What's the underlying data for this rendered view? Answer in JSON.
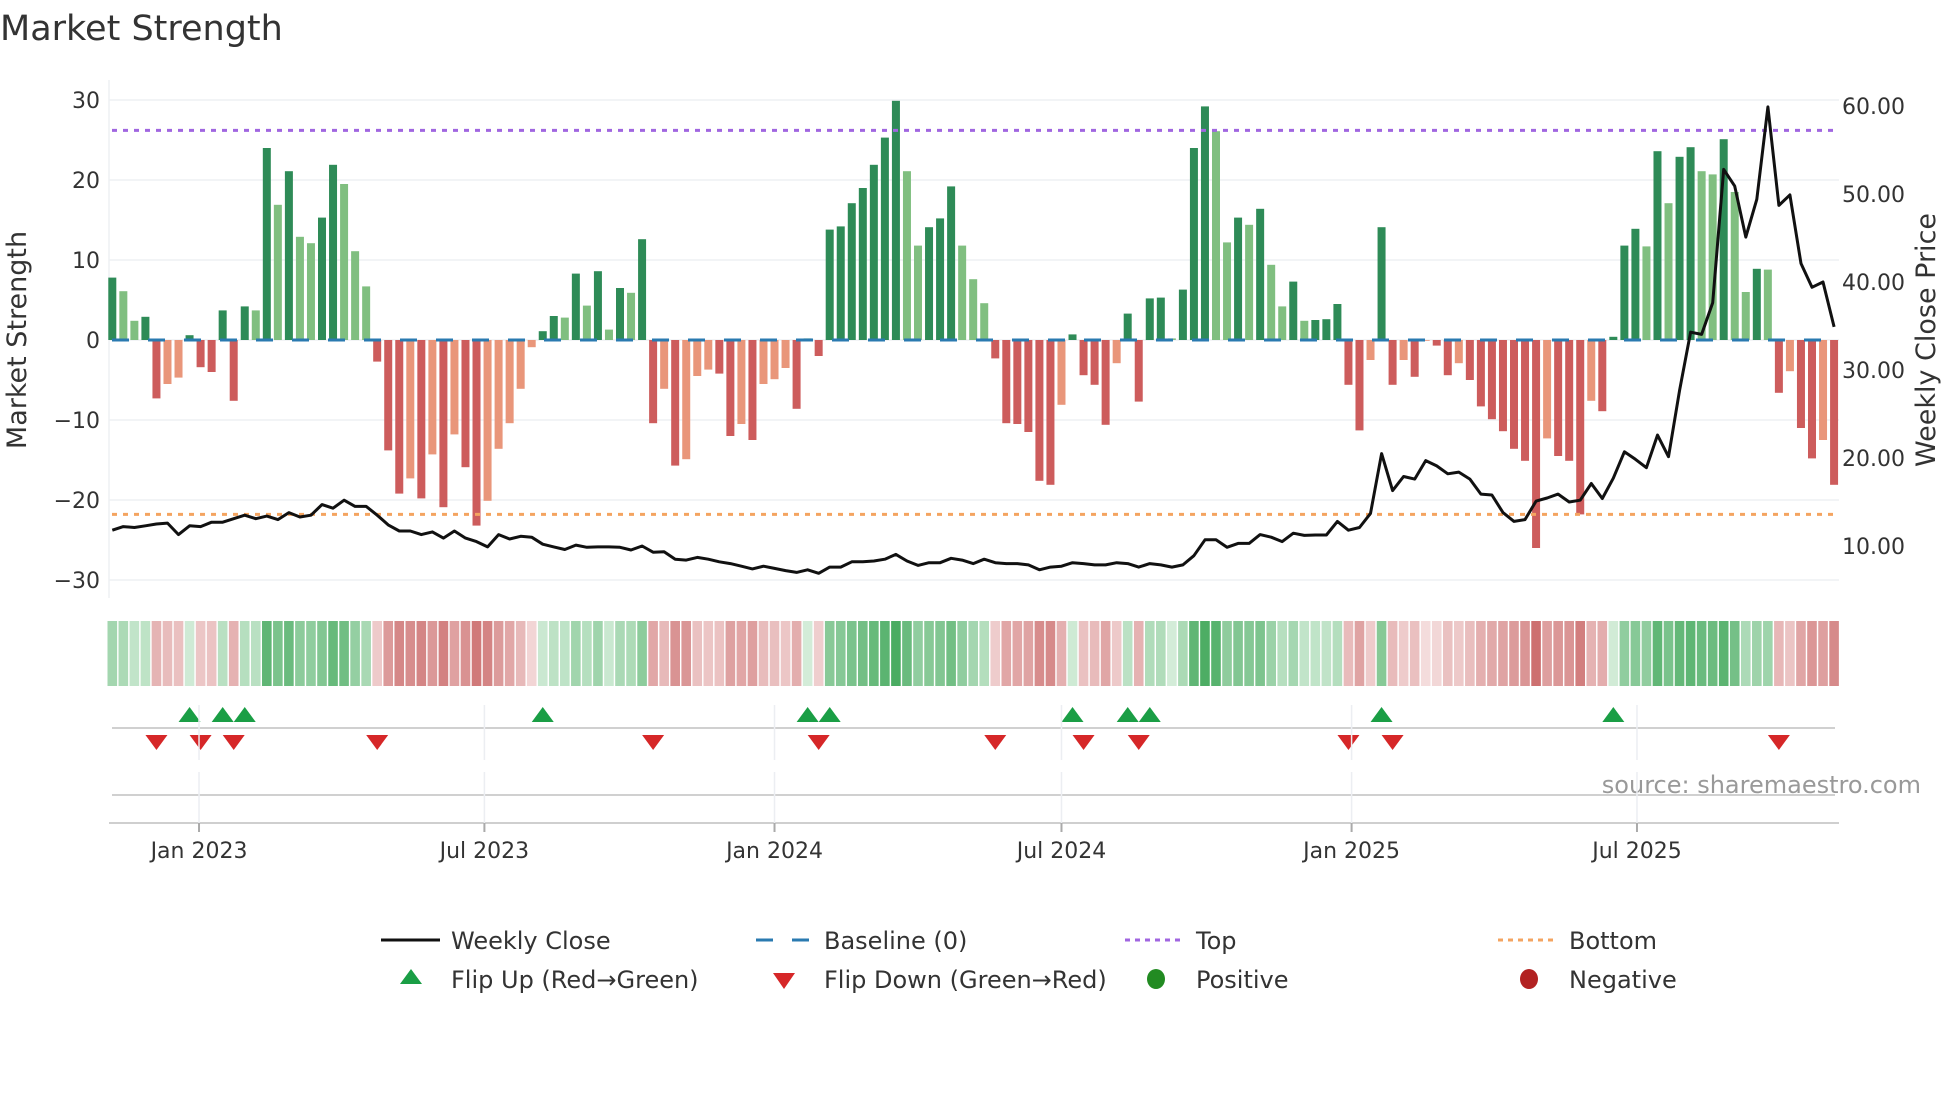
{
  "chart_data": {
    "type": "bar",
    "title": "Market Strength",
    "ylabel": "Market Strength",
    "y2label": "Weekly Close Price",
    "ylim": [
      -32,
      32
    ],
    "y2lim": [
      4.7,
      61.1
    ],
    "y_ticks": [
      "30",
      "20",
      "10",
      "0",
      "−10",
      "−20",
      "−30"
    ],
    "y_tick_values": [
      30,
      20,
      10,
      0,
      -10,
      -20,
      -30
    ],
    "y2_ticks": [
      "60.00",
      "50.00",
      "40.00",
      "30.00",
      "20.00",
      "10.00"
    ],
    "y2_tick_values": [
      60,
      50,
      40,
      30,
      20,
      10
    ],
    "x_ticks": [
      "Jan 2023",
      "Jul 2023",
      "Jan 2024",
      "Jul 2024",
      "Jan 2025",
      "Jul 2025"
    ],
    "x_tick_dates": [
      "2023-01-01",
      "2023-07-01",
      "2024-01-01",
      "2024-07-01",
      "2025-01-01",
      "2025-07-01"
    ],
    "x_start_date": "2022-11-07",
    "x_step": "weekly",
    "top_level": 26.2,
    "bottom_level": -21.8,
    "baseline": 0,
    "strength": [
      7.8,
      6.1,
      2.4,
      2.9,
      -7.3,
      -5.5,
      -4.7,
      0.6,
      -3.4,
      -4.0,
      3.7,
      -7.6,
      4.2,
      3.7,
      24.0,
      16.9,
      21.1,
      12.9,
      12.1,
      15.3,
      21.9,
      19.5,
      11.1,
      6.7,
      -2.7,
      -13.8,
      -19.2,
      -17.3,
      -19.8,
      -14.3,
      -20.9,
      -11.8,
      -15.9,
      -23.2,
      -20.1,
      -13.6,
      -10.4,
      -6.1,
      -0.9,
      1.1,
      3.0,
      2.8,
      8.3,
      4.3,
      8.6,
      1.3,
      6.5,
      5.9,
      12.6,
      -10.4,
      -6.1,
      -15.7,
      -14.9,
      -4.5,
      -3.7,
      -4.2,
      -12.0,
      -10.5,
      -12.5,
      -5.5,
      -4.9,
      -3.5,
      -8.6,
      0.2,
      -2.0,
      13.8,
      14.2,
      17.1,
      19.0,
      21.9,
      25.3,
      29.9,
      21.1,
      11.8,
      14.1,
      15.2,
      19.2,
      11.8,
      7.6,
      4.6,
      -2.3,
      -10.4,
      -10.5,
      -11.5,
      -17.6,
      -18.1,
      -8.1,
      0.7,
      -4.4,
      -5.6,
      -10.6,
      -2.9,
      3.3,
      -7.7,
      5.2,
      5.3,
      0.2,
      6.3,
      24.0,
      29.2,
      26.1,
      12.2,
      15.3,
      14.4,
      16.4,
      9.4,
      4.2,
      7.3,
      2.4,
      2.5,
      2.6,
      4.5,
      -5.6,
      -11.3,
      -2.5,
      14.1,
      -5.6,
      -2.5,
      -4.6,
      -0.1,
      -0.7,
      -4.4,
      -2.9,
      -5.0,
      -8.3,
      -9.9,
      -11.4,
      -13.6,
      -15.1,
      -26.0,
      -12.3,
      -14.5,
      -15.1,
      -21.8,
      -7.6,
      -8.9,
      0.4,
      11.8,
      13.9,
      11.7,
      23.6,
      17.1,
      22.9,
      24.1,
      21.1,
      20.7,
      25.1,
      18.5,
      6.0,
      8.9,
      8.8,
      -6.6,
      -3.9,
      -11.0,
      -14.8,
      -12.5,
      -18.1
    ],
    "weekly_close": [
      11.8,
      12.2,
      12.1,
      12.3,
      12.5,
      12.6,
      11.3,
      12.3,
      12.2,
      12.7,
      12.7,
      13.1,
      13.5,
      13.1,
      13.4,
      13.0,
      13.8,
      13.3,
      13.5,
      14.7,
      14.3,
      15.2,
      14.5,
      14.5,
      13.5,
      12.4,
      11.7,
      11.7,
      11.3,
      11.6,
      10.9,
      11.7,
      10.9,
      10.5,
      9.9,
      11.3,
      10.8,
      11.1,
      11.0,
      10.2,
      9.9,
      9.6,
      10.1,
      9.85,
      9.9,
      9.9,
      9.85,
      9.55,
      10.0,
      9.3,
      9.35,
      8.5,
      8.4,
      8.7,
      8.5,
      8.2,
      8.0,
      7.7,
      7.4,
      7.7,
      7.45,
      7.2,
      7.0,
      7.3,
      6.9,
      7.6,
      7.6,
      8.2,
      8.2,
      8.3,
      8.5,
      9.05,
      8.3,
      7.8,
      8.1,
      8.1,
      8.6,
      8.4,
      8.0,
      8.5,
      8.1,
      8.0,
      8.0,
      7.85,
      7.3,
      7.6,
      7.7,
      8.1,
      8.0,
      7.85,
      7.85,
      8.1,
      8.0,
      7.6,
      8.0,
      7.85,
      7.6,
      7.85,
      8.9,
      10.7,
      10.7,
      9.85,
      10.3,
      10.3,
      11.3,
      11.0,
      10.5,
      11.45,
      11.2,
      11.25,
      11.25,
      12.8,
      11.8,
      12.1,
      13.7,
      20.5,
      16.3,
      17.9,
      17.6,
      19.7,
      19.1,
      18.2,
      18.4,
      17.6,
      15.9,
      15.8,
      13.8,
      12.8,
      13.0,
      15.1,
      15.45,
      15.9,
      15.0,
      15.2,
      17.1,
      15.4,
      17.7,
      20.7,
      19.85,
      18.9,
      22.6,
      20.15,
      27.7,
      34.3,
      34.05,
      37.65,
      52.8,
      50.9,
      45.1,
      49.4,
      59.9,
      48.7,
      49.9,
      42.1,
      39.4,
      40.0,
      34.9
    ],
    "legend": {
      "weekly_close": "Weekly Close",
      "baseline": "Baseline (0)",
      "top": "Top",
      "bottom": "Bottom",
      "flip_up": "Flip Up (Red→Green)",
      "flip_down": "Flip Down (Green→Red)",
      "positive": "Positive",
      "negative": "Negative"
    },
    "legend_placement": "bottom",
    "source": "source: sharemaestro.com",
    "colors": {
      "pos_rising": "#2e8b57",
      "pos_falling": "#80bf80",
      "neg_falling": "#cd5c5c",
      "neg_rising": "#e9967a",
      "line": "#111111",
      "baseline": "#2a7ab0",
      "top": "#a066e0",
      "bottom": "#f4a460",
      "flip_up": "#1a9e45",
      "flip_down": "#d62728",
      "positive": "#228b22",
      "negative": "#b22222",
      "grid": "#eef0f3"
    }
  }
}
